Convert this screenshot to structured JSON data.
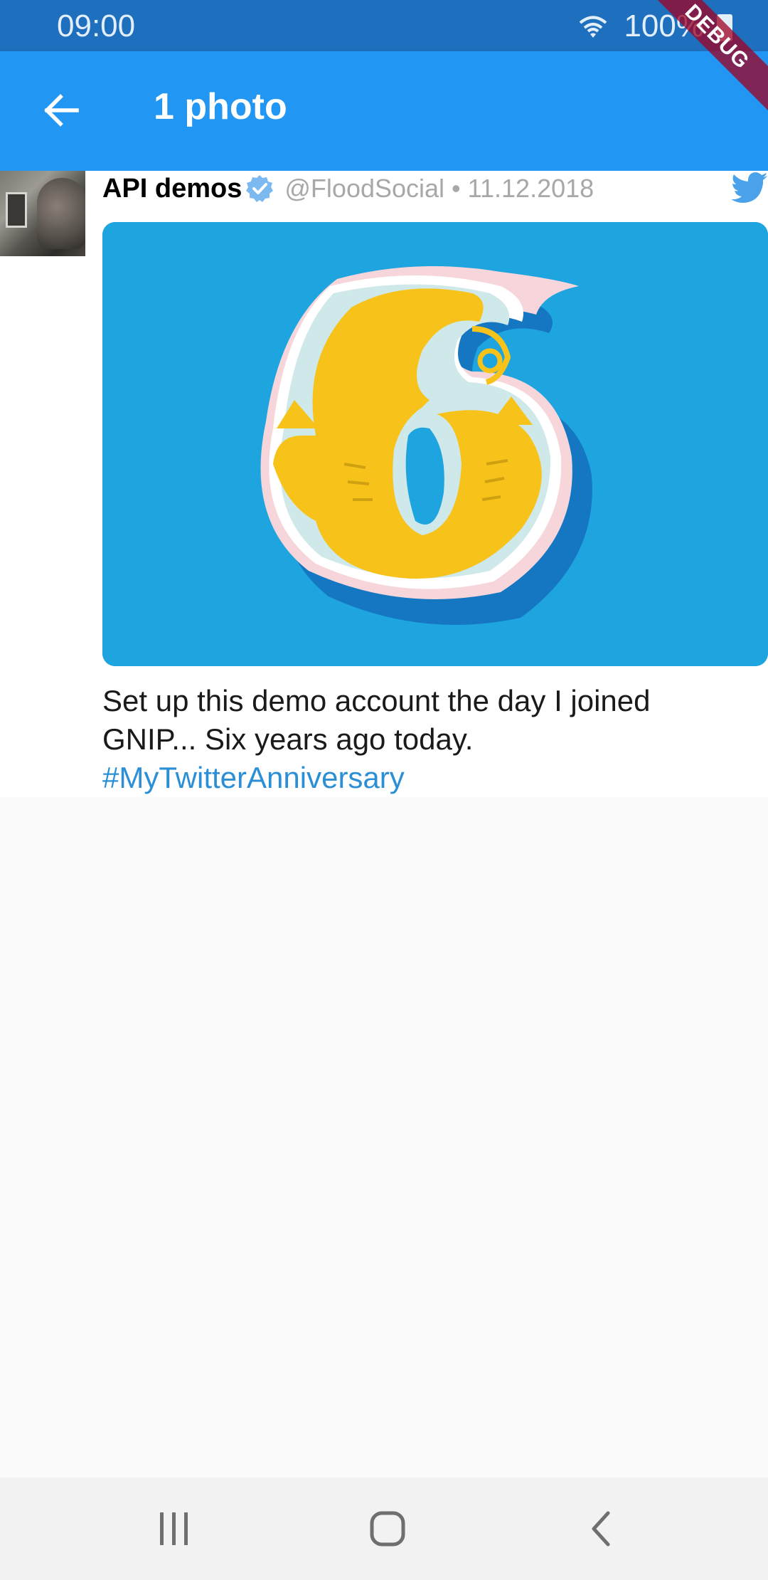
{
  "status_bar": {
    "time": "09:00",
    "battery": "100%",
    "wifi_icon": "wifi-icon",
    "battery_icon": "battery-icon"
  },
  "debug_banner": "DEBUG",
  "app_bar": {
    "title": "1 photo",
    "back_icon": "arrow-left-icon",
    "background": "#2196f3"
  },
  "tweet": {
    "author_name": "API demos",
    "verified": true,
    "handle": "@FloodSocial",
    "separator": "•",
    "date": "11.12.2018",
    "text": "Set up this demo account the day I joined GNIP... Six years ago today.",
    "hashtag": "#MyTwitterAnniversary",
    "hashtag_color": "#2a8fd6",
    "image_description_icon": "number-six-papercut-image",
    "brand_icon": "twitter-bird-icon",
    "brand_color": "#1da1f2"
  },
  "nav_bar": {
    "recent_icon": "recent-apps-icon",
    "home_icon": "home-icon",
    "back_icon": "back-icon"
  }
}
